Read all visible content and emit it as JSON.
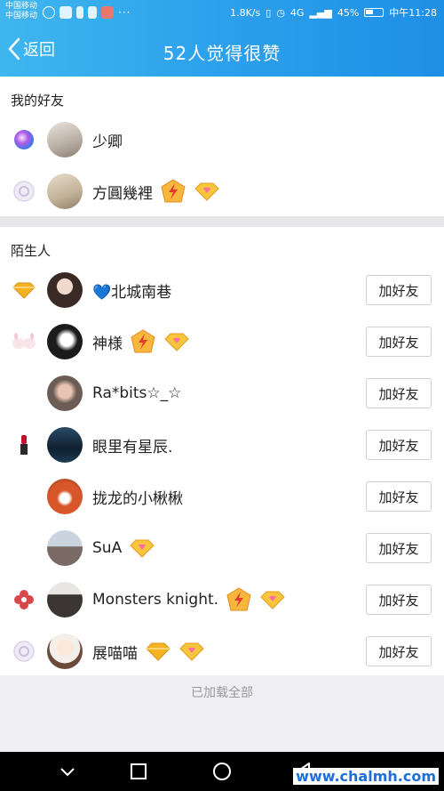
{
  "status_bar": {
    "carrier_1": "中国移动",
    "carrier_2": "中国移动",
    "net_speed": "1.8K/s",
    "signal_text": "4G",
    "battery": "45%",
    "time": "中午11:28"
  },
  "nav": {
    "back_label": "返回",
    "title": "52人觉得很赞"
  },
  "friends": {
    "header": "我的好友",
    "items": [
      {
        "name": "少卿",
        "badge": "orb-icon",
        "tags": []
      },
      {
        "name": "方圓幾裡",
        "badge": "swirl-badge-icon",
        "tags": [
          "svip-lightning-icon",
          "diamond-icon"
        ]
      }
    ]
  },
  "strangers": {
    "header": "陌生人",
    "add_label": "加好友",
    "items": [
      {
        "name": "💙北城南巷",
        "badge": "gold-diamond-badge-icon",
        "tags": []
      },
      {
        "name": "神様",
        "badge": "bunny-badge-icon",
        "tags": [
          "svip-lightning-icon",
          "diamond-icon"
        ]
      },
      {
        "name": "Ra*bits☆_☆",
        "badge": "",
        "tags": []
      },
      {
        "name": "眼里有星辰.",
        "badge": "lipstick-icon",
        "tags": []
      },
      {
        "name": "拢龙的小楸楸",
        "badge": "",
        "tags": []
      },
      {
        "name": "SuA",
        "badge": "",
        "tags": [
          "diamond-icon"
        ]
      },
      {
        "name": "Monsters knight.",
        "badge": "red-knot-icon",
        "tags": [
          "svip-lightning-icon",
          "diamond-icon"
        ]
      },
      {
        "name": "展喵喵",
        "badge": "swirl-badge-icon",
        "tags": [
          "gold-diamond-icon",
          "diamond-icon"
        ]
      }
    ]
  },
  "footer": {
    "text": "已加载全部"
  },
  "watermark": "www.chalmh.com",
  "colors": {
    "nav_start": "#3fb6ee",
    "nav_end": "#1e8fe6",
    "diamond": "#f5b321"
  }
}
